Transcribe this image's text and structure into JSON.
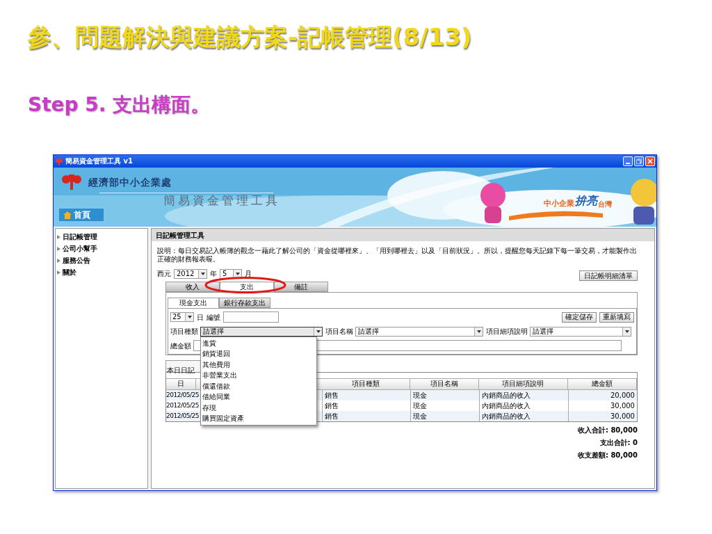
{
  "slide": {
    "title": "參、問題解決與建議方案-記帳管理(8/13)",
    "subtitle": "Step 5. 支出構面。"
  },
  "window": {
    "title": "簡易資金管理工具 v1"
  },
  "banner": {
    "agency": "經濟部中小企業處",
    "app_name": "簡易資金管理工具",
    "home": "首頁",
    "slogan": [
      "中小企業",
      "拚亮",
      "台灣"
    ]
  },
  "sidebar": {
    "items": [
      {
        "label": "日記帳管理"
      },
      {
        "label": "公司小幫手"
      },
      {
        "label": "服務公告"
      },
      {
        "label": "關於"
      }
    ]
  },
  "panel": {
    "title": "日記帳管理工具",
    "description": "說明：每日交易記入帳簿的觀念一藉此了解公司的「資金從哪裡來」、「用到哪裡去」以及「目前狀況」。所以，提醒您每天記錄下每一筆交易，才能製作出正確的財務報表喔。",
    "era_label": "西元",
    "year": "2012",
    "year_unit": "年",
    "month": "5",
    "month_unit": "月",
    "list_button": "日記帳明細清單",
    "tabs": [
      {
        "label": "收入",
        "selected": false
      },
      {
        "label": "支出",
        "selected": true
      },
      {
        "label": "備註",
        "selected": false
      }
    ],
    "subtabs": [
      {
        "label": "現金支出",
        "selected": true
      },
      {
        "label": "銀行存款支出",
        "selected": false
      }
    ],
    "day": "25",
    "day_unit": "日",
    "number_label": "編號",
    "save_button": "確定儲存",
    "reset_button": "重新填寫",
    "fields": [
      {
        "label": "項目種類",
        "value": "請選擇",
        "expanded": true,
        "options": [
          "進貨",
          "銷貨退回",
          "其他費用",
          "非營業支出",
          "償還借款",
          "借給同業",
          "存現",
          "購買固定資產"
        ]
      },
      {
        "label": "項目名稱",
        "value": "請選擇",
        "expanded": false
      },
      {
        "label": "項目細項說明",
        "value": "請選擇",
        "expanded": false
      }
    ],
    "amount_label": "總金額",
    "journal": {
      "tab": "本日日記",
      "columns": [
        "日",
        "項目種類",
        "項目名稱",
        "項目細項說明",
        "總金額"
      ],
      "rows": [
        [
          "2012/05/25",
          "銷售",
          "現金",
          "內銷商品的收入",
          "20,000"
        ],
        [
          "2012/05/25",
          "銷售",
          "現金",
          "內銷商品的收入",
          "30,000"
        ],
        [
          "2012/05/25",
          "銷售",
          "現金",
          "內銷商品的收入",
          "30,000"
        ]
      ]
    },
    "totals": [
      "收入合計: 80,000",
      "支出合計: 0",
      "收支差額: 80,000"
    ]
  }
}
